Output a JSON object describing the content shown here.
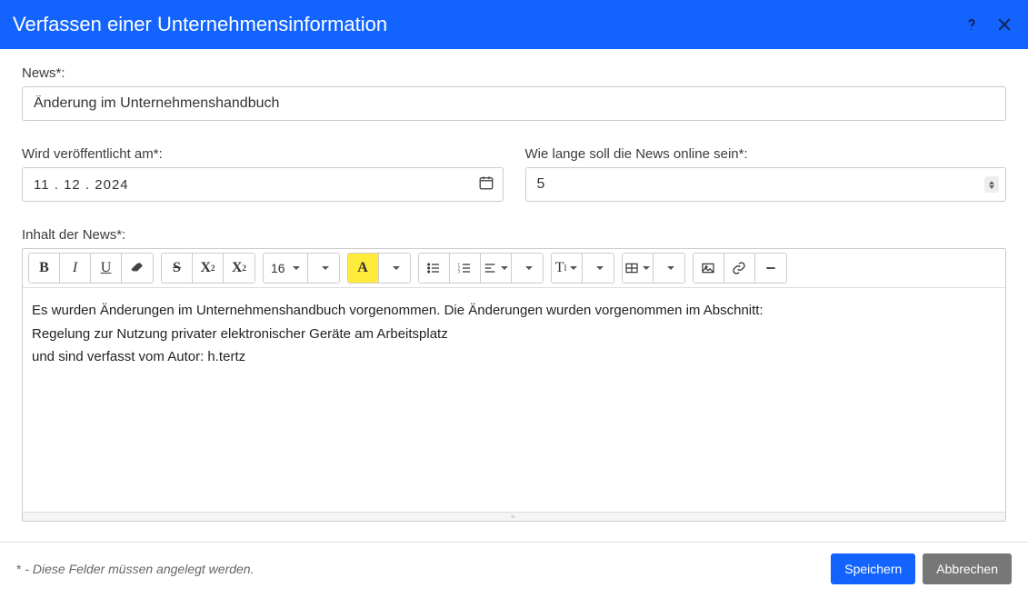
{
  "header": {
    "title": "Verfassen einer Unternehmensinformation"
  },
  "fields": {
    "news_label": "News*:",
    "news_value": "Änderung im Unternehmenshandbuch",
    "publish_label": "Wird veröffentlicht am*:",
    "publish_value": "11 . 12 . 2024",
    "duration_label": "Wie lange soll die News online sein*:",
    "duration_value": "5",
    "content_label": "Inhalt der News*:"
  },
  "toolbar": {
    "font_size": "16"
  },
  "content": {
    "line1": "Es wurden Änderungen im Unternehmenshandbuch vorgenommen. Die Änderungen wurden vorgenommen im Abschnitt:",
    "line2": "Regelung zur Nutzung privater elektronischer Geräte am Arbeitsplatz",
    "line3": "und sind verfasst vom Autor: h.tertz"
  },
  "footer": {
    "hint_ast": "*",
    "hint_text": " - Diese Felder müssen angelegt werden.",
    "save": "Speichern",
    "cancel": "Abbrechen"
  }
}
